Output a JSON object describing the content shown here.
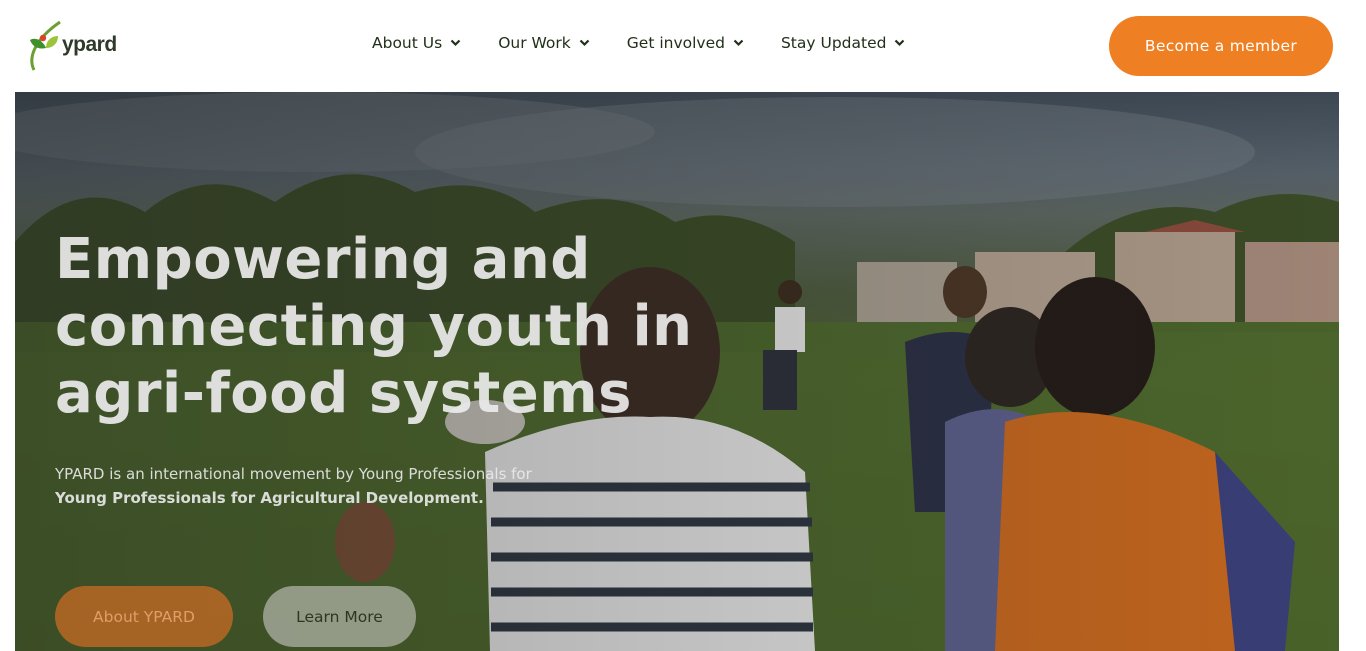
{
  "brand": {
    "name": "ypard",
    "logo_icon": "ypard-leaf-logo"
  },
  "nav": {
    "items": [
      {
        "label": "About Us",
        "icon": "chevron-down-icon"
      },
      {
        "label": "Our Work",
        "icon": "chevron-down-icon"
      },
      {
        "label": "Get involved",
        "icon": "chevron-down-icon"
      },
      {
        "label": "Stay Updated",
        "icon": "chevron-down-icon"
      }
    ]
  },
  "header": {
    "cta_label": "Become a member"
  },
  "hero": {
    "title": "Empowering and connecting youth in agri-food systems",
    "subtitle_plain": "YPARD is an international movement by Young Professionals for ",
    "subtitle_bold": "Young Professionals for Agricultural Development.",
    "primary_button": "About YPARD",
    "secondary_button": "Learn More"
  },
  "colors": {
    "accent": "#ef7f23",
    "text_dark": "#22301a",
    "hero_text": "#ebebeb"
  }
}
